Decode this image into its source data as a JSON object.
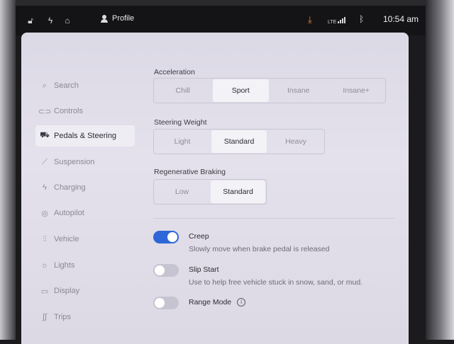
{
  "status_bar": {
    "profile_label": "Profile",
    "network": "LTE",
    "time": "10:54 am",
    "download_color": "#e8873a"
  },
  "sidebar": {
    "items": [
      {
        "label": "Search",
        "icon": "search-icon"
      },
      {
        "label": "Controls",
        "icon": "toggle-icon"
      },
      {
        "label": "Pedals & Steering",
        "icon": "car-icon",
        "active": true
      },
      {
        "label": "Suspension",
        "icon": "suspension-icon"
      },
      {
        "label": "Charging",
        "icon": "bolt-icon"
      },
      {
        "label": "Autopilot",
        "icon": "steering-wheel-icon"
      },
      {
        "label": "Vehicle",
        "icon": "sliders-icon"
      },
      {
        "label": "Lights",
        "icon": "sun-icon"
      },
      {
        "label": "Display",
        "icon": "display-icon"
      },
      {
        "label": "Trips",
        "icon": "trips-icon"
      }
    ]
  },
  "settings": {
    "acceleration": {
      "title": "Acceleration",
      "options": [
        "Chill",
        "Sport",
        "Insane",
        "Insane+"
      ],
      "selected": "Sport"
    },
    "steering_weight": {
      "title": "Steering Weight",
      "options": [
        "Light",
        "Standard",
        "Heavy"
      ],
      "selected": "Standard"
    },
    "regenerative_braking": {
      "title": "Regenerative Braking",
      "options": [
        "Low",
        "Standard"
      ],
      "selected": "Standard"
    },
    "toggles": [
      {
        "label": "Creep",
        "description": "Slowly move when brake pedal is released",
        "on": true
      },
      {
        "label": "Slip Start",
        "description": "Use to help free vehicle stuck in snow, sand, or mud.",
        "on": false
      },
      {
        "label": "Range Mode",
        "description": "",
        "on": false,
        "info": true
      }
    ]
  },
  "colors": {
    "accent_toggle_on": "#2f66d8",
    "panel_bg": "#e0dde8"
  }
}
